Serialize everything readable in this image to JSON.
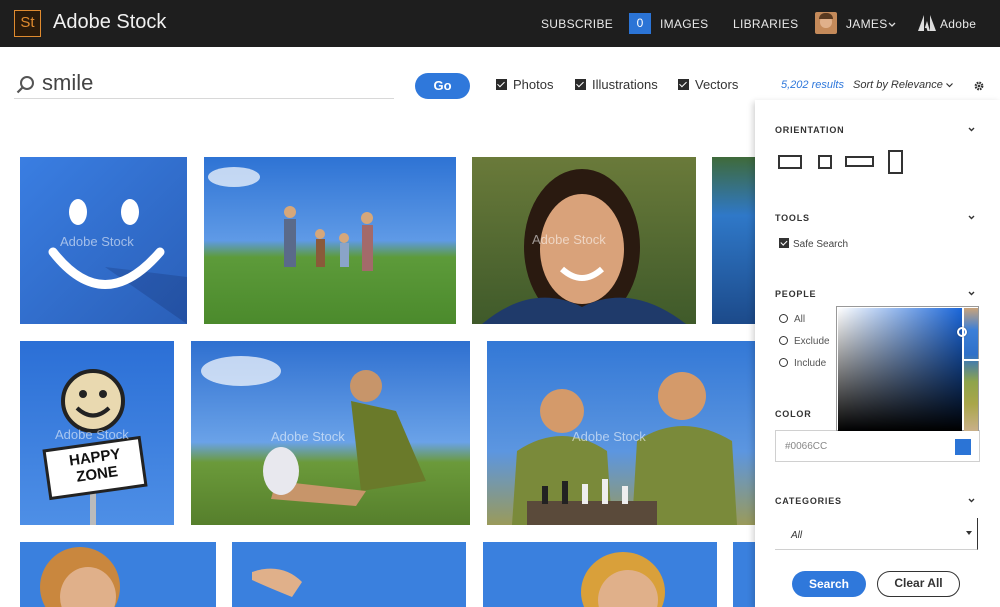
{
  "header": {
    "logo_text": "St",
    "brand": "Adobe Stock",
    "nav": {
      "subscribe": "SUBSCRIBE",
      "images_count": "0",
      "images": "IMAGES",
      "libraries": "LIBRARIES",
      "user": "JAMES",
      "adobe": "Adobe"
    }
  },
  "search": {
    "query": "smile",
    "go_label": "Go",
    "filters": [
      "Photos",
      "Illustrations",
      "Vectors"
    ],
    "results": "5,202 results",
    "sort": "Sort by Relevance"
  },
  "grid": {
    "watermark": "Adobe Stock",
    "sign_text": [
      "HAPPY",
      "ZONE"
    ]
  },
  "panel": {
    "orientation": "ORIENTATION",
    "tools": "TOOLS",
    "safe_search": "Safe Search",
    "people": "PEOPLE",
    "people_options": [
      "All",
      "Exclude",
      "Include"
    ],
    "color": "COLOR",
    "color_value": "#0066CC",
    "categories": "CATEGORIES",
    "category_value": "All",
    "search_button": "Search",
    "clear_button": "Clear All"
  },
  "colors": {
    "accent": "#2f78db",
    "brand_orange": "#e08b2f",
    "topbar": "#1e1e1e"
  }
}
